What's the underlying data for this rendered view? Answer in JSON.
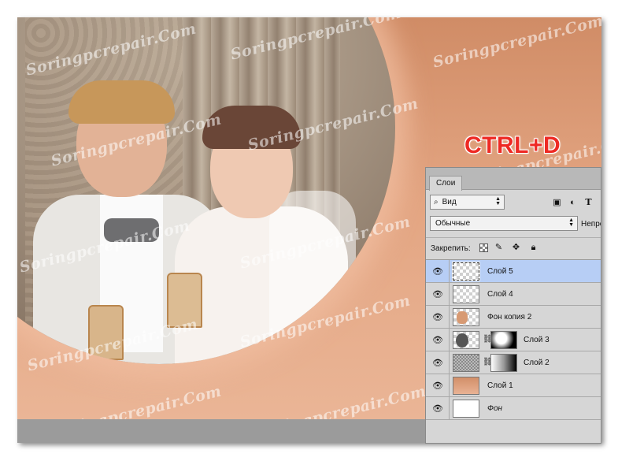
{
  "overlay": {
    "shortcut_text": "CTRL+D"
  },
  "watermarks": [
    "Soringpcrepair.Com"
  ],
  "layers_panel": {
    "tab_label": "Слои",
    "filter": {
      "selected": "Вид",
      "icon": "search-icon"
    },
    "filter_icons": [
      "image-icon",
      "adjustment-icon",
      "text-icon"
    ],
    "blend_mode": "Обычные",
    "opacity_label": "Непрозрачность",
    "lock_label": "Закрепить:",
    "lock_icons": [
      "lock-transparent-icon",
      "brush-icon",
      "move-icon",
      "lock-icon"
    ],
    "layers": [
      {
        "name": "Слой 5",
        "visible": true,
        "selected": true,
        "thumb": "transparent"
      },
      {
        "name": "Слой 4",
        "visible": true,
        "selected": false,
        "thumb": "transparent"
      },
      {
        "name": "Фон копия 2",
        "visible": true,
        "selected": false,
        "thumb": "photo"
      },
      {
        "name": "Слой 3",
        "visible": true,
        "selected": false,
        "thumb": "circle",
        "has_mask": true
      },
      {
        "name": "Слой 2",
        "visible": true,
        "selected": false,
        "thumb": "texture",
        "has_mask": true
      },
      {
        "name": "Слой 1",
        "visible": true,
        "selected": false,
        "thumb": "peach"
      },
      {
        "name": "Фон",
        "visible": true,
        "selected": false,
        "thumb": "white",
        "italic": true
      }
    ]
  }
}
